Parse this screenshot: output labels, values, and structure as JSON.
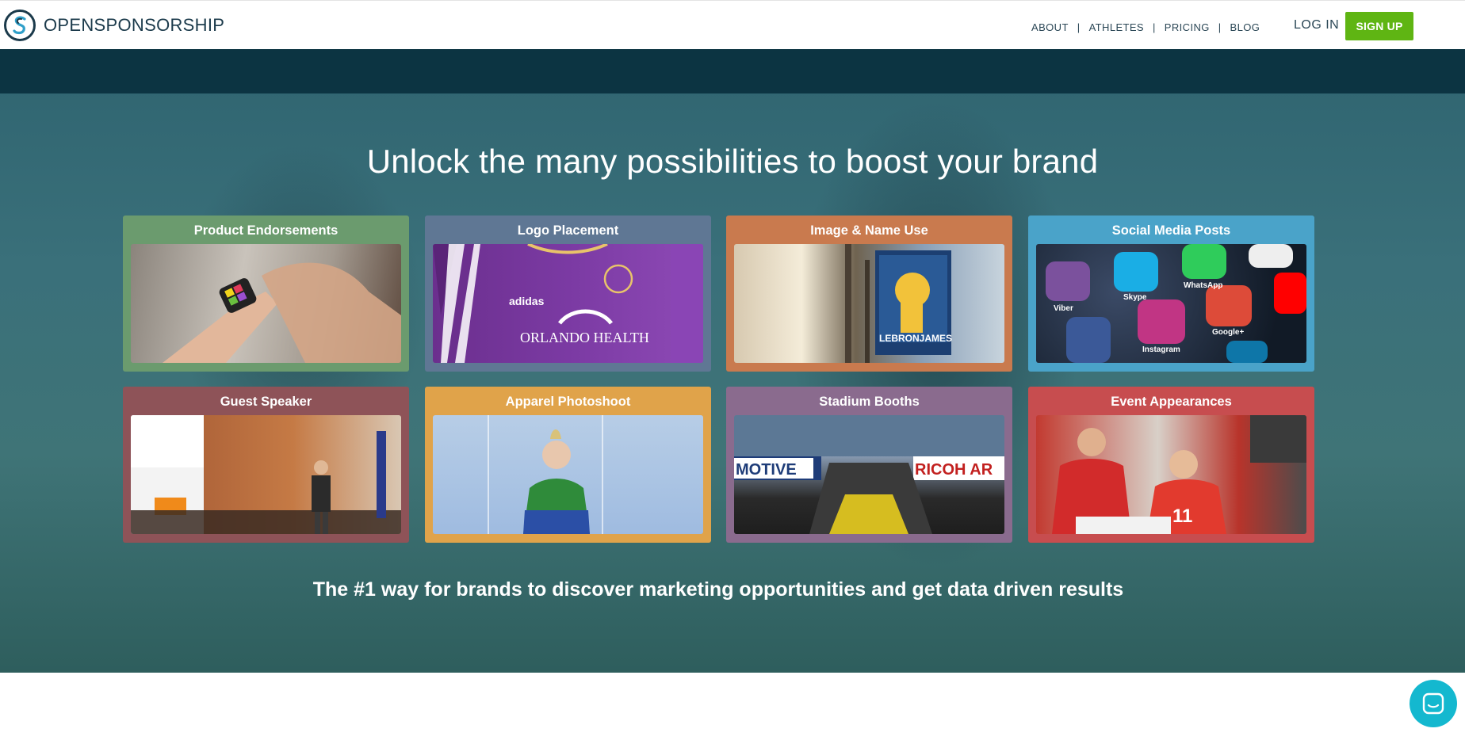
{
  "brand": {
    "name": "OPENSPONSORSHIP"
  },
  "nav": {
    "items": [
      "ABOUT",
      "ATHLETES",
      "PRICING",
      "BLOG"
    ],
    "separator": "|",
    "login_label": "LOG IN",
    "signup_label": "SIGN UP"
  },
  "hero": {
    "title": "Unlock the many possibilities to boost your brand",
    "tagline": "The #1 way for brands to discover marketing opportunities and get data driven results",
    "cards": [
      {
        "label": "Product Endorsements",
        "color": "#6b9b6e"
      },
      {
        "label": "Logo Placement",
        "color": "#5f7794"
      },
      {
        "label": "Image & Name Use",
        "color": "#c97a4e"
      },
      {
        "label": "Social Media Posts",
        "color": "#4aa3c9"
      },
      {
        "label": "Guest Speaker",
        "color": "#8e5358"
      },
      {
        "label": "Apparel Photoshoot",
        "color": "#e0a34a"
      },
      {
        "label": "Stadium Booths",
        "color": "#8a6b8e"
      },
      {
        "label": "Event Appearances",
        "color": "#c74d4f"
      }
    ]
  },
  "photo_text": {
    "logo_brand": "adidas",
    "logo_sponsor": "ORLANDO HEALTH",
    "billboard": "LEBRONJAMES",
    "stadium_left": "MOTIVE",
    "stadium_right": "RICOH AR",
    "jersey_number": "11",
    "social_viber": "Viber",
    "social_skype": "Skype",
    "social_whatsapp": "WhatsApp",
    "social_googleplus": "Google+",
    "social_instagram": "Instagram"
  },
  "colors": {
    "accent": "#5fb513",
    "header_text": "#2b4756",
    "band": "#0c3442",
    "chat": "#14b8cf"
  }
}
